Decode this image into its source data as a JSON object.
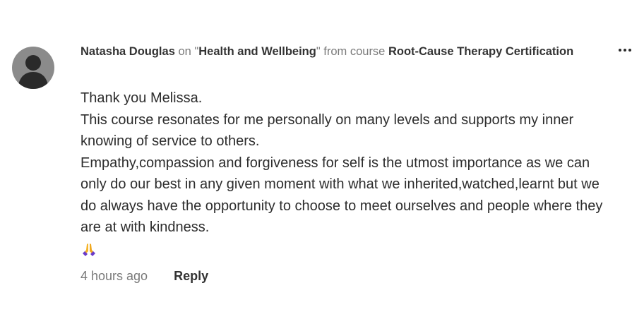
{
  "comment": {
    "author": "Natasha Douglas",
    "on_text": " on \"",
    "lesson": "Health and Wellbeing",
    "from_text": "\" from course ",
    "course": "Root-Cause Therapy Certification",
    "body_lines": [
      "Thank you Melissa.",
      "This course resonates for me personally on many levels and supports my inner knowing of service to others.",
      "Empathy,compassion and forgiveness for self is the utmost importance as we can only do our best in any given moment with what we inherited,watched,learnt but we do always have the opportunity to choose to meet ourselves and people where they are at with kindness."
    ],
    "emoji": "folded-hands-icon",
    "timestamp": "4 hours ago",
    "reply_label": "Reply",
    "more_icon": "more-options-icon"
  },
  "colors": {
    "text": "#2d2d2d",
    "muted": "#7a7a7a",
    "avatar_bg": "#8b8b8b",
    "avatar_fg": "#2a2a2a"
  }
}
